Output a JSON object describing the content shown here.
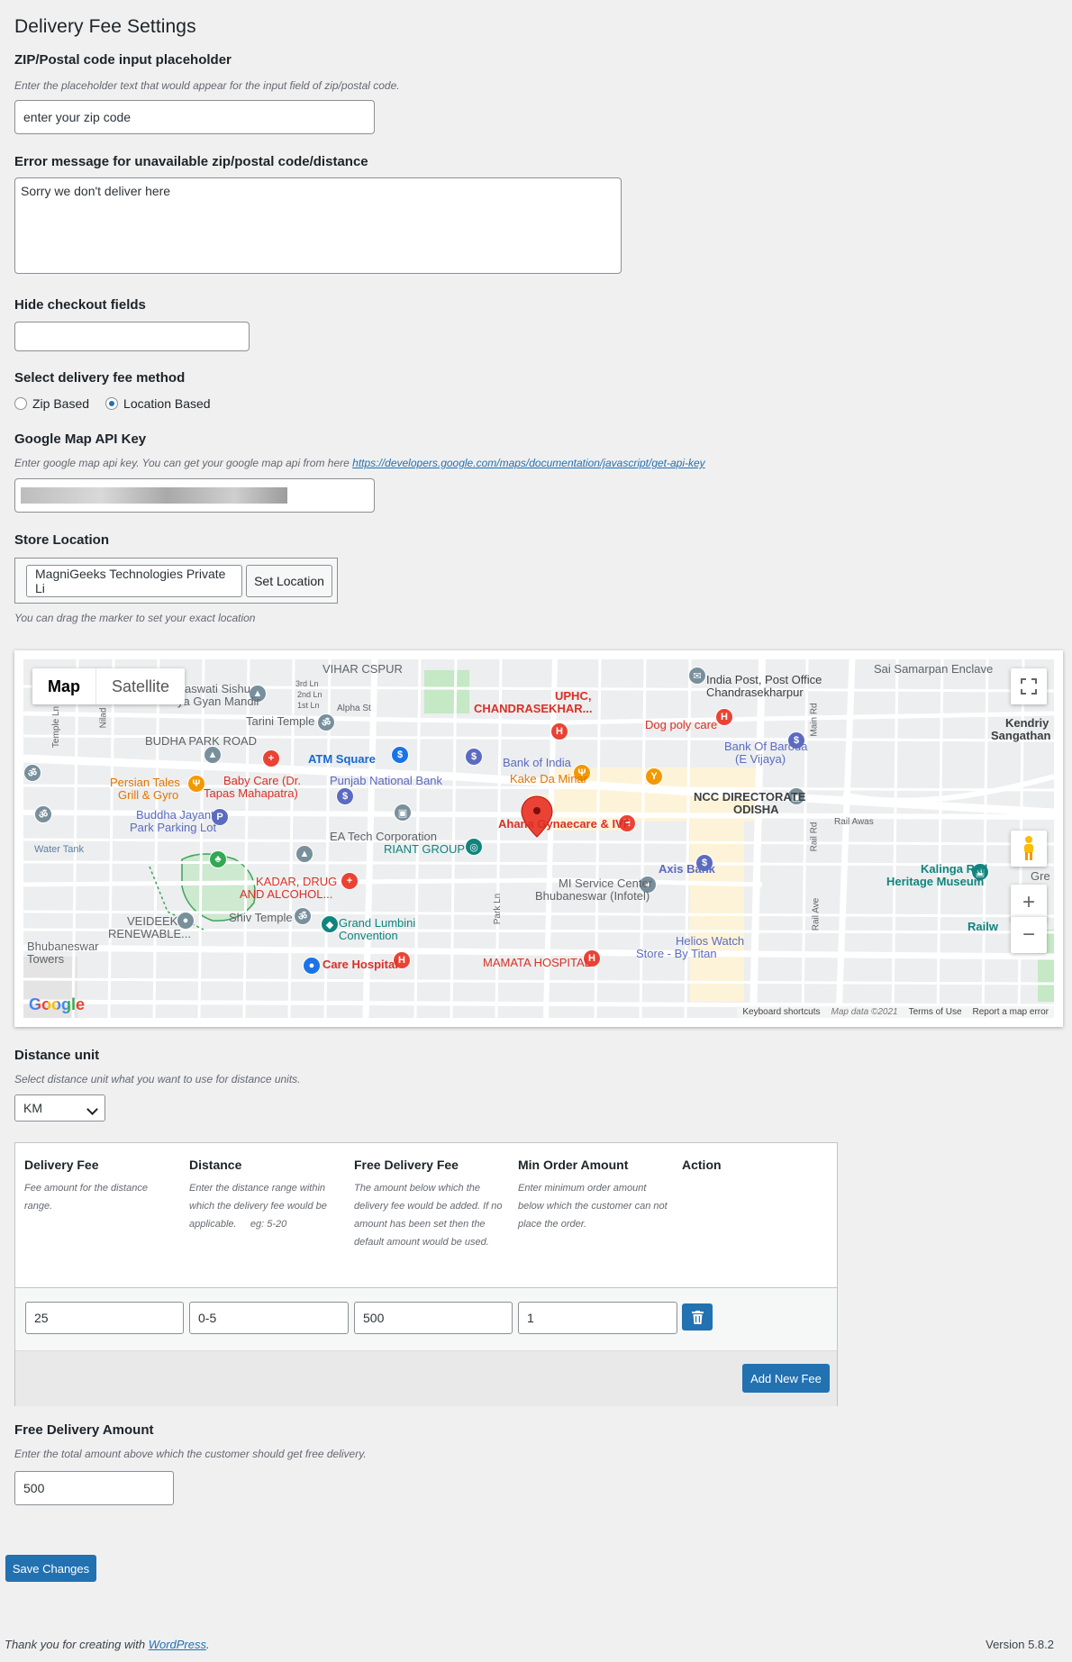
{
  "page": {
    "title": "Delivery Fee Settings",
    "version": "Version 5.8.2",
    "footer_prefix": "Thank you for creating with",
    "footer_link": "WordPress",
    "footer_suffix": "."
  },
  "zip_placeholder": {
    "label": "ZIP/Postal code input placeholder",
    "description": "Enter the placeholder text that would appear for the input field of zip/postal code.",
    "value": "enter your zip code"
  },
  "error_message": {
    "label": "Error message for unavailable zip/postal code/distance",
    "value": "Sorry we don't deliver here"
  },
  "hide_checkout": {
    "label": "Hide checkout fields",
    "value": ""
  },
  "fee_method": {
    "label": "Select delivery fee method",
    "options": [
      "Zip Based",
      "Location Based"
    ],
    "selected": "Location Based"
  },
  "api_key": {
    "label": "Google Map API Key",
    "description": "Enter google map api key. You can get your google map api from here",
    "link": "https://developers.google.com/maps/documentation/javascript/get-api-key"
  },
  "store_location": {
    "label": "Store Location",
    "value": "MagniGeeks Technologies Private Li",
    "button": "Set Location",
    "hint": "You can drag the marker to set your exact location"
  },
  "map": {
    "tabs": [
      "Map",
      "Satellite"
    ],
    "active_tab": "Map",
    "logo": "Google",
    "attribution": [
      "Keyboard shortcuts",
      "Map data ©2021",
      "Terms of Use",
      "Report a map error"
    ],
    "labels": {
      "vihar": "VIHAR CSPUR",
      "sishu": "aswati Sishu",
      "gyan": "ya Gyan Mandir",
      "tarini": "Tarini Temple",
      "budha": "BUDHA PARK ROAD",
      "atm": "ATM Square",
      "pnb": "Punjab National Bank",
      "persian1": "Persian Tales",
      "persian2": "Grill & Gyro",
      "babycare1": "Baby Care (Dr.",
      "babycare2": "Tapas Mahapatra)",
      "buddha1": "Buddha Jayanti",
      "buddha2": "Park Parking Lot",
      "watertank": "Water Tank",
      "ea": "EA Tech Corporation",
      "riant": "RIANT GROUP",
      "kadar1": "KADAR, DRUG",
      "kadar2": "AND ALCOHOL...",
      "veideek1": "VEIDEEK",
      "veideek2": "RENEWABLE...",
      "shiv": "Shiv Temple",
      "lumbini1": "Grand Lumbini",
      "lumbini2": "Convention",
      "care": "Care Hospital",
      "bbsr1": "Bhubaneswar",
      "bbsr2": "Towers",
      "uphc1": "UPHC,",
      "uphc2": "CHANDRASEKHAR...",
      "boi": "Bank of India",
      "kake": "Kake Da Minar",
      "ahana": "Ahana Gynaecare & IVF",
      "mi1": "MI Service Center",
      "mi2": "Bhubaneswar (Infotel)",
      "mamata": "MAMATA HOSPITAL",
      "helios1": "Helios Watch",
      "helios2": "Store - By Titan",
      "axis": "Axis Bank",
      "ncc1": "NCC DIRECTORATE",
      "ncc2": "ODISHA",
      "baroda1": "Bank Of Baroda",
      "baroda2": "(E Vijaya)",
      "dogpoly": "Dog poly care",
      "indiapost1": "India Post, Post Office",
      "indiapost2": "Chandrasekharpur",
      "samarpan": "Sai Samarpan Enclave",
      "kendriy1": "Kendriy",
      "kendriy2": "Sangathan",
      "kalinga1": "Kalinga Rail",
      "kalinga2": "Heritage Museum",
      "railawas": "Rail Awas",
      "railway": "Railw",
      "gre": "Gre",
      "parkln": "Park Ln",
      "mainrd": "Main Rd",
      "railrd": "Rail Rd",
      "railave": "Rail Ave",
      "alphast": "Alpha St",
      "templeln": "Temple Ln",
      "ln3": "3rd Ln",
      "ln2": "2nd Ln",
      "ln1": "1st Ln",
      "nilad": "Nilad"
    }
  },
  "distance_unit": {
    "label": "Distance unit",
    "description": "Select distance unit what you want to use for distance units.",
    "selected": "KM"
  },
  "fee_table": {
    "columns": [
      {
        "title": "Delivery Fee",
        "desc": "Fee amount for the distance range."
      },
      {
        "title": "Distance",
        "desc": "Enter the distance range within which the delivery fee would be applicable.     eg: 5-20"
      },
      {
        "title": "Free Delivery Fee",
        "desc": "The amount below which the delivery fee would be added. If no amount has been set then the default amount would be used."
      },
      {
        "title": "Min Order Amount",
        "desc": "Enter minimum order amount below which the customer can not place the order."
      },
      {
        "title": "Action",
        "desc": ""
      }
    ],
    "rows": [
      {
        "fee": "25",
        "distance": "0-5",
        "free": "500",
        "min": "1"
      }
    ],
    "add_button": "Add New Fee"
  },
  "free_delivery": {
    "label": "Free Delivery Amount",
    "description": "Enter the total amount above which the customer should get free delivery.",
    "value": "500"
  },
  "save_button": "Save Changes",
  "colors": {
    "primary": "#2271b1",
    "background": "#f0f0f1",
    "map_pin_red": "#ea4335",
    "map_pin_blue": "#5c6bc0",
    "map_pin_orange": "#f29900"
  }
}
